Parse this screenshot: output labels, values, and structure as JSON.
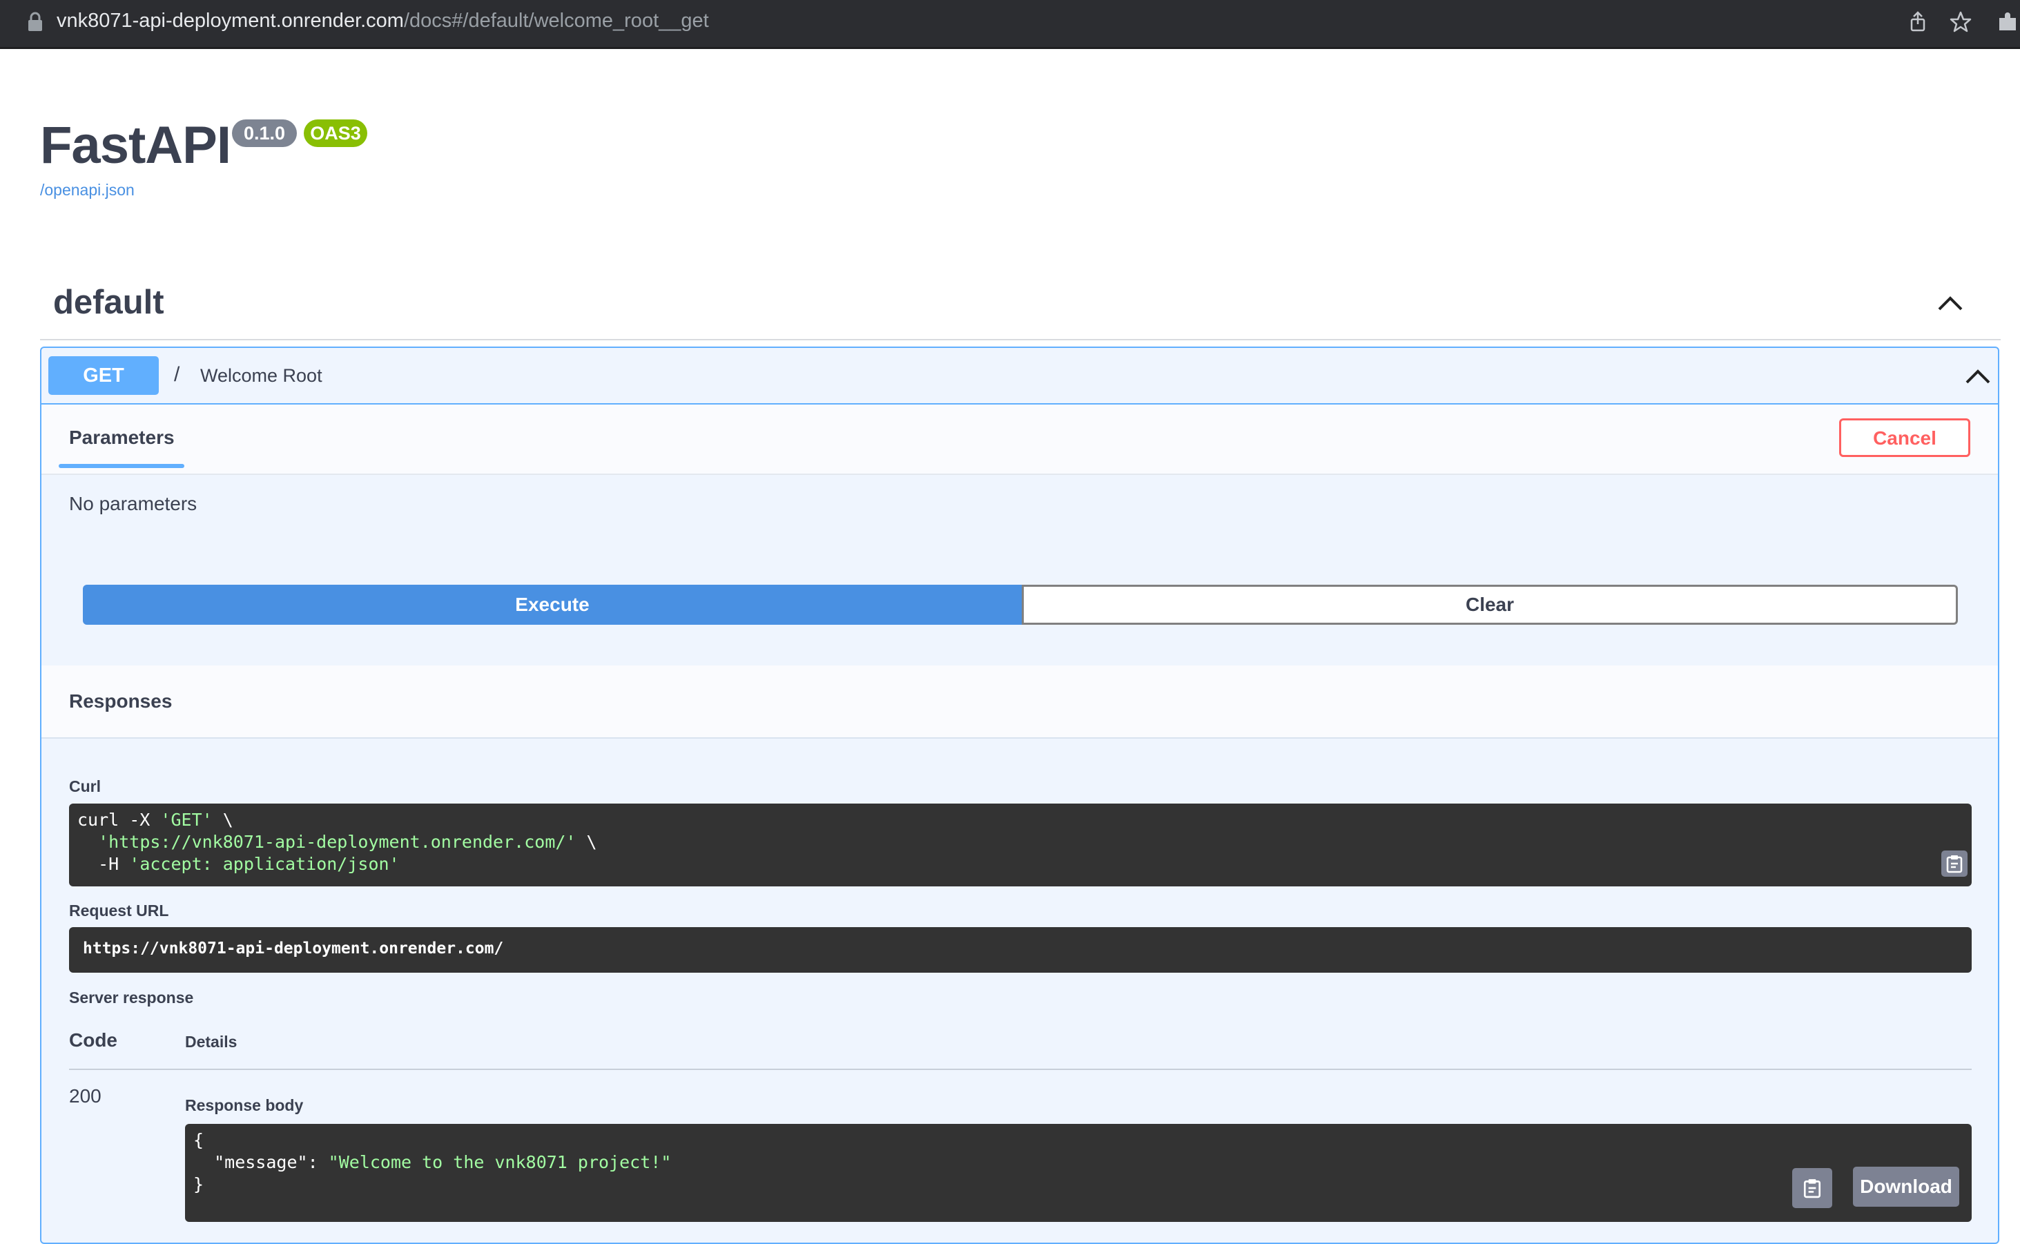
{
  "browser": {
    "url_host": "vnk8071-api-deployment.onrender.com",
    "url_rest": "/docs#/default/welcome_root__get"
  },
  "header": {
    "title": "FastAPI",
    "version_badge": "0.1.0",
    "oas_badge": "OAS3",
    "openapi_link": "/openapi.json"
  },
  "section": {
    "title": "default"
  },
  "operation": {
    "method": "GET",
    "path": "/",
    "summary": "Welcome Root",
    "parameters_tab": "Parameters",
    "cancel_label": "Cancel",
    "no_params": "No parameters",
    "execute_label": "Execute",
    "clear_label": "Clear"
  },
  "responses": {
    "title": "Responses",
    "curl_label": "Curl",
    "curl_lines": [
      {
        "pre": "curl -X ",
        "str": "'GET'",
        "post": " \\"
      },
      {
        "pre": "  ",
        "str": "'https://vnk8071-api-deployment.onrender.com/'",
        "post": " \\"
      },
      {
        "pre": "  -H ",
        "str": "'accept: application/json'",
        "post": ""
      }
    ],
    "request_url_label": "Request URL",
    "request_url": "https://vnk8071-api-deployment.onrender.com/",
    "server_response_label": "Server response",
    "col_code": "Code",
    "col_details": "Details",
    "status_code": "200",
    "response_body_label": "Response body",
    "body_open": "{",
    "body_key": "  \"message\": ",
    "body_value": "\"Welcome to the vnk8071 project!\"",
    "body_close": "}",
    "download_label": "Download"
  },
  "colors": {
    "get_blue": "#61affe",
    "execute_blue": "#4990e2",
    "cancel_red": "#ff6060",
    "oas_green": "#89bf04"
  }
}
